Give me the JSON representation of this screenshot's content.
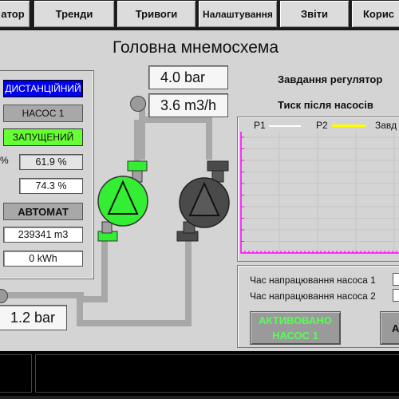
{
  "nav": {
    "tabs": [
      {
        "label": "атор"
      },
      {
        "label": "Тренди"
      },
      {
        "label": "Тривоги"
      },
      {
        "label": "Налаштування"
      },
      {
        "label": "Звіти"
      },
      {
        "label": "Корис"
      }
    ]
  },
  "title": "Головна мнемосхема",
  "left_panel": {
    "mode": "ДИСТАНЦІЙНИЙ",
    "pump_name": "НАСОС 1",
    "state": "ЗАПУЩЕНИЙ",
    "pct_symbol": "%",
    "value1": "61.9 %",
    "value2": "74.3 %",
    "auto_label": "АВТОМАТ",
    "volume": "239341 m3",
    "energy": "0 kWh"
  },
  "readouts": {
    "pressure_top": "4.0 bar",
    "flow": "3.6 m3/h",
    "pressure_bottom": "1.2 bar"
  },
  "right_labels": {
    "setpoint": "Завдання регулятор",
    "pressure_after": "Тиск після насосів"
  },
  "chart_data": {
    "type": "line",
    "series": [
      {
        "name": "P1",
        "color": "#ffffff",
        "values": []
      },
      {
        "name": "P2",
        "color": "#ffff00",
        "values": []
      },
      {
        "name": "Завд",
        "color": "#ffffff",
        "values": []
      }
    ],
    "grid": true,
    "axis_color": "#ff00ff"
  },
  "bottom_panel": {
    "hours1_label": "Час напрацювання насоса 1",
    "hours2_label": "Час напрацювання насоса 2",
    "activated_line1": "АКТИВОВАНО",
    "activated_line2": "НАСОС 1",
    "second_button_fragment": "А"
  },
  "colors": {
    "remote_badge": "#0000ee",
    "running_badge": "#66ff33",
    "pump_on": "#33ee33",
    "pump_off": "#4a4a4a",
    "pipe": "#a8a8a8"
  }
}
